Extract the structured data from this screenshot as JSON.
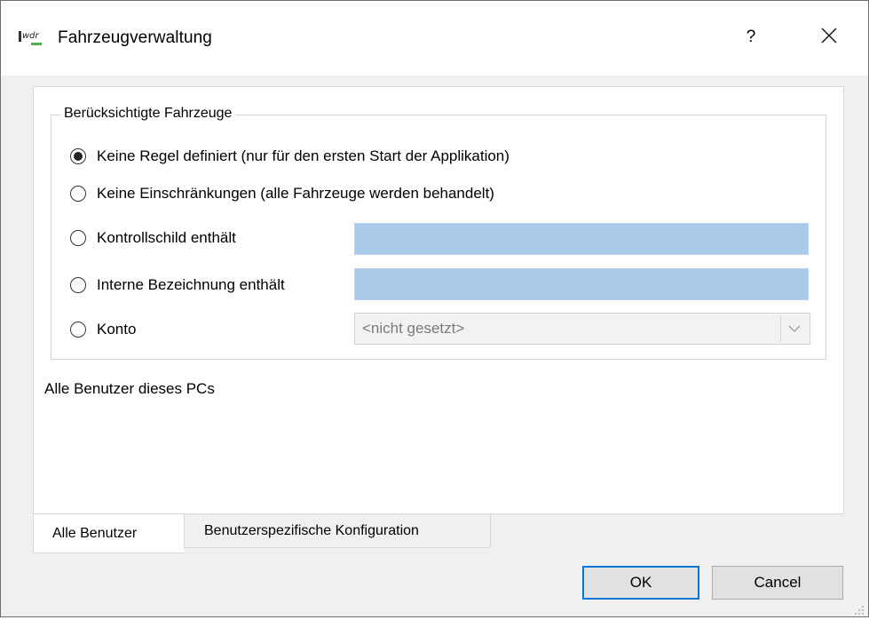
{
  "window": {
    "title": "Fahrzeugverwaltung",
    "help_label": "?",
    "close_label": "✕",
    "icon": "app-logo-icon"
  },
  "group": {
    "legend": "Berücksichtigte Fahrzeuge",
    "options": [
      {
        "label": "Keine Regel definiert (nur für den ersten Start der Applikation)",
        "checked": true
      },
      {
        "label": "Keine Einschränkungen (alle Fahrzeuge werden behandelt)",
        "checked": false
      },
      {
        "label": "Kontrollschild enthält",
        "checked": false
      },
      {
        "label": "Interne Bezeichnung enthält",
        "checked": false
      },
      {
        "label": "Konto",
        "checked": false
      }
    ],
    "kontrollschild_value": "",
    "interne_bezeichnung_value": "",
    "konto_selected": "<nicht gesetzt>"
  },
  "info_text": "Alle Benutzer dieses PCs",
  "tabs": [
    {
      "label": "Alle Benutzer",
      "active": true
    },
    {
      "label": "Benutzerspezifische Konfiguration",
      "active": false
    }
  ],
  "buttons": {
    "ok": "OK",
    "cancel": "Cancel"
  },
  "colors": {
    "field_fill": "#aacbe9",
    "default_button_border": "#0078d7",
    "dialog_background": "#f0f0f0"
  }
}
